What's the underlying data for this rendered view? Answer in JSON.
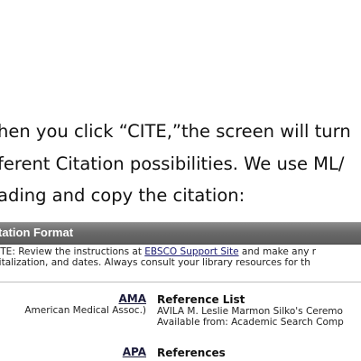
{
  "instructions": {
    "line1": "hen you click “CITE,”the screen will turn",
    "line2": "ferent Citation possibilities. We use ML/",
    "line3": "ading and copy the citation:"
  },
  "panel": {
    "title": "tation Format",
    "note_prefix": "OTE: Review the instructions at ",
    "note_link": "EBSCO Support Site",
    "note_suffix": " and make any r",
    "note_line2": "pitalization, and dates. Always consult your library resources for th"
  },
  "citations": [
    {
      "style": "AMA",
      "description": "American Medical Assoc.)",
      "heading": "Reference List",
      "lines": [
        "AVILA M. Leslie Marmon Silko's Ceremo",
        "Available from: Academic Search Comp"
      ]
    },
    {
      "style": "APA",
      "heading": "References"
    }
  ]
}
